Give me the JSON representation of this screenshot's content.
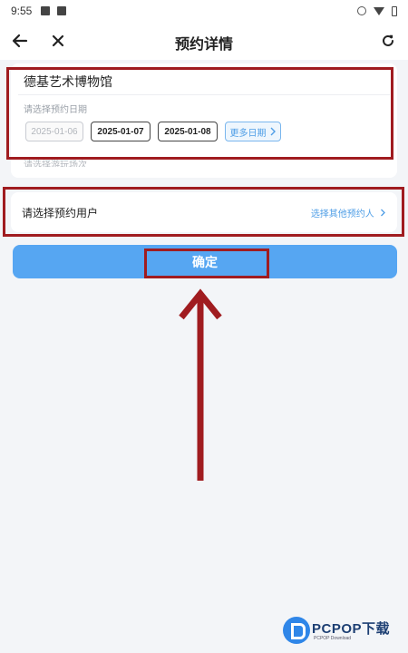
{
  "status_bar": {
    "time": "9:55"
  },
  "nav": {
    "title": "预约详情",
    "back_icon": "arrow-left-icon",
    "close_icon": "close-icon",
    "refresh_icon": "refresh-icon"
  },
  "venue": {
    "name": "德基艺术博物馆",
    "date_label": "请选择预约日期",
    "dates": [
      {
        "label": "2025-01-06",
        "state": "disabled"
      },
      {
        "label": "2025-01-07",
        "state": "available"
      },
      {
        "label": "2025-01-08",
        "state": "available"
      }
    ],
    "more_dates": "更多日期",
    "partial_text": "请选择游玩场次"
  },
  "user": {
    "label": "请选择预约用户",
    "other_link": "选择其他预约人"
  },
  "confirm": {
    "label": "确定"
  },
  "watermark": {
    "brand": "PCPOP下载",
    "sub": "PCPOP Download"
  },
  "colors": {
    "accent": "#56a6f2",
    "highlight": "#a01c20",
    "link": "#4f9ee6"
  }
}
